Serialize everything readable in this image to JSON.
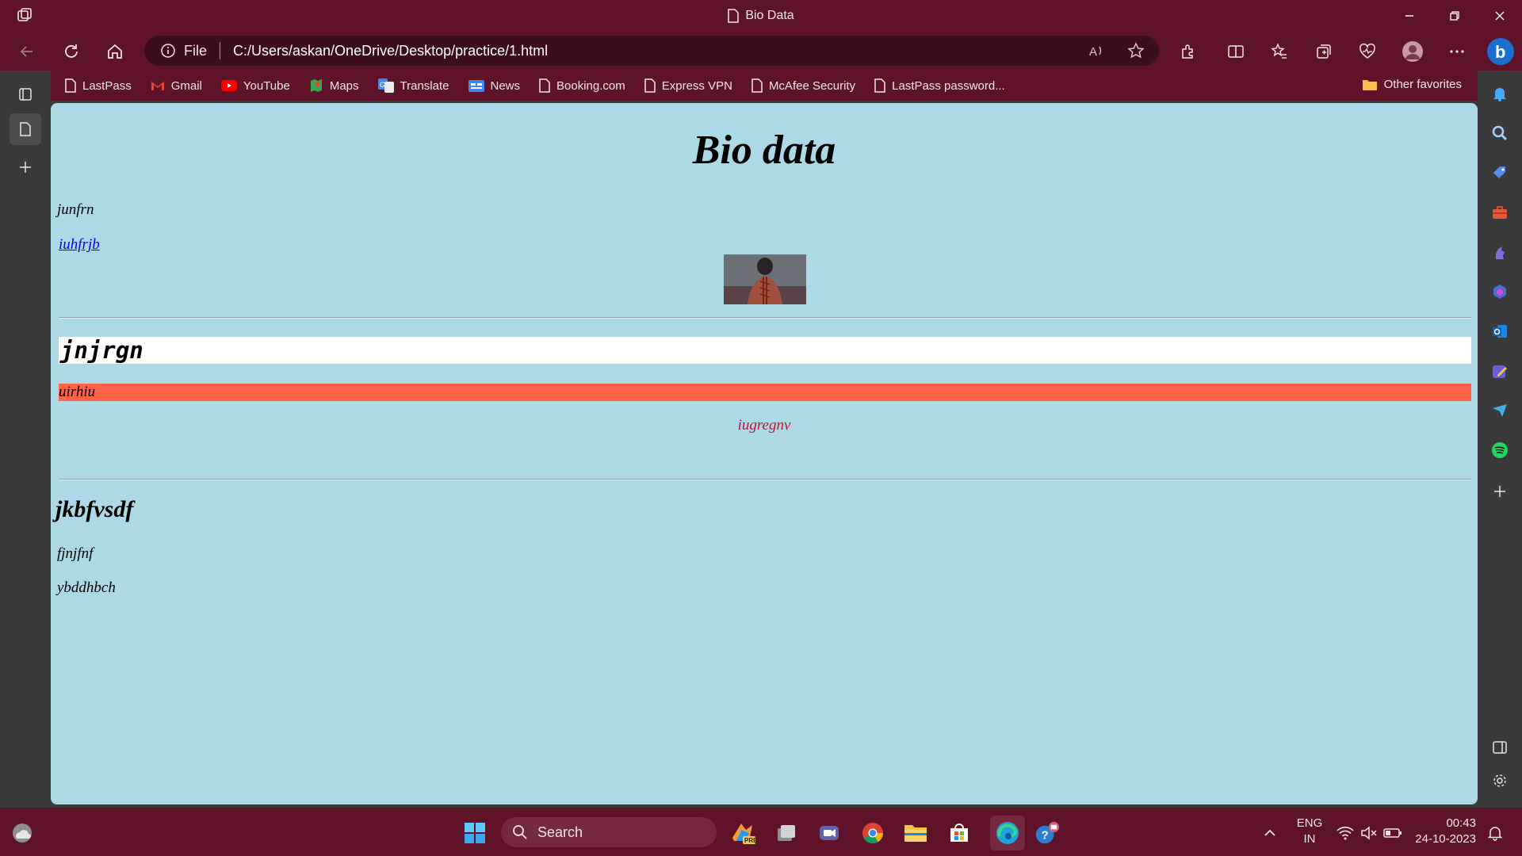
{
  "window": {
    "title": "Bio Data"
  },
  "address": {
    "scheme_label": "File",
    "url": "C:/Users/askan/OneDrive/Desktop/practice/1.html"
  },
  "favorites": [
    {
      "label": "LastPass",
      "icon": "page-icon"
    },
    {
      "label": "Gmail",
      "icon": "gmail-icon"
    },
    {
      "label": "YouTube",
      "icon": "youtube-icon"
    },
    {
      "label": "Maps",
      "icon": "maps-icon"
    },
    {
      "label": "Translate",
      "icon": "translate-icon"
    },
    {
      "label": "News",
      "icon": "news-icon"
    },
    {
      "label": "Booking.com",
      "icon": "page-icon"
    },
    {
      "label": "Express VPN",
      "icon": "page-icon"
    },
    {
      "label": "McAfee Security",
      "icon": "page-icon"
    },
    {
      "label": "LastPass password...",
      "icon": "page-icon"
    }
  ],
  "favorites_other": "Other favorites",
  "page": {
    "heading": "Bio data",
    "para1": "junfrn",
    "link": "iuhfrjb",
    "h2": "jnjrgn",
    "orange_text": "uirhiu",
    "red_text": "iugregnv",
    "h3": "jkbfvsdf",
    "para2": "fjnjfnf",
    "para3": "ybddhbch"
  },
  "taskbar": {
    "search_placeholder": "Search",
    "lang_top": "ENG",
    "lang_bottom": "IN",
    "time": "00:43",
    "date": "24-10-2023"
  },
  "colors": {
    "frame": "#5f1329",
    "page_bg": "#add8e6",
    "orange_bar": "#ff6347",
    "red_text": "#c8102e",
    "link": "#0000ee"
  }
}
